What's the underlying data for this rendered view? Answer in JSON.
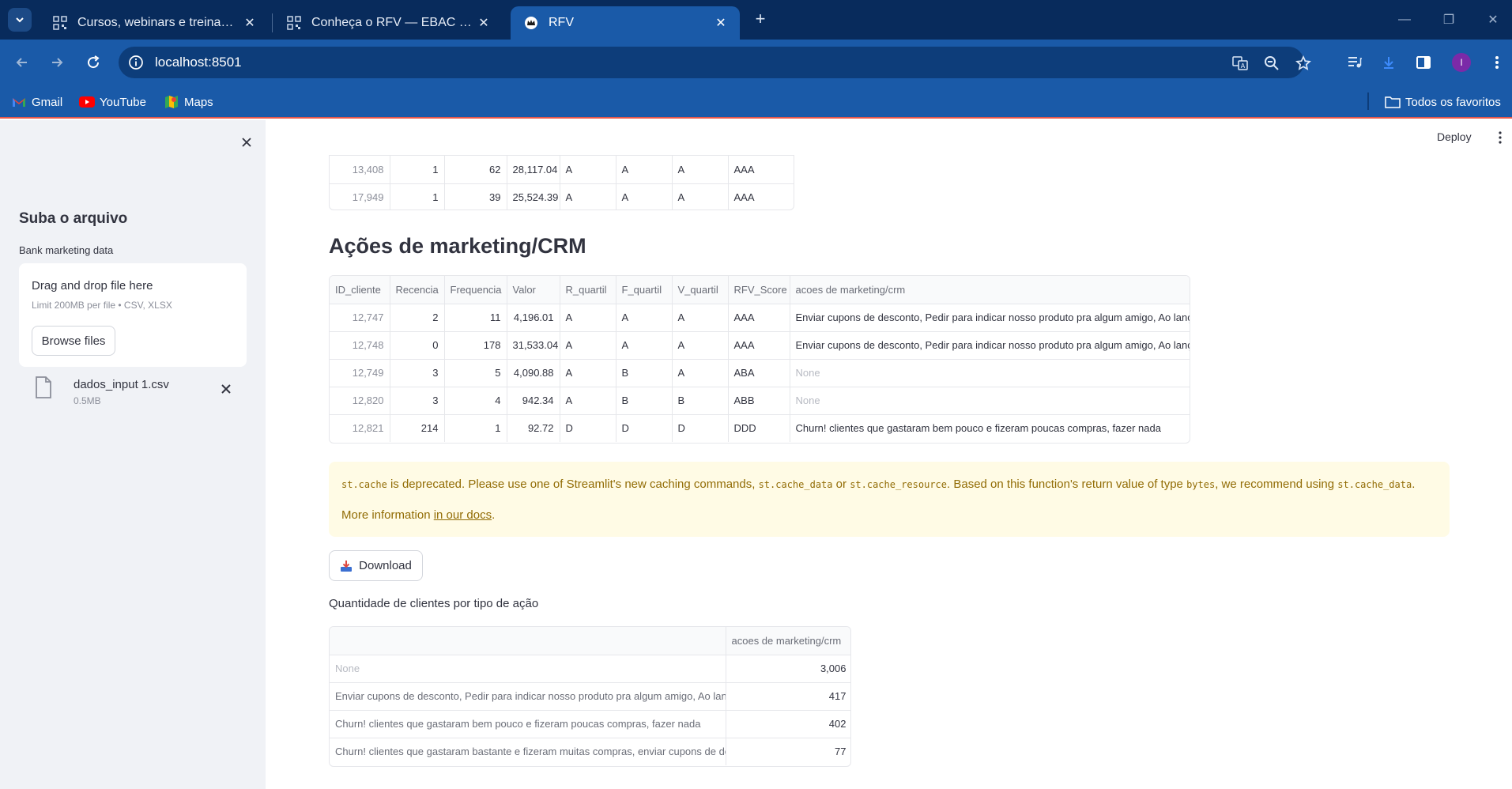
{
  "browser": {
    "tabs": [
      {
        "title": "Cursos, webinars e treinamentos",
        "active": false
      },
      {
        "title": "Conheça o RFV — EBAC LMS",
        "active": false
      },
      {
        "title": "RFV",
        "active": true
      }
    ],
    "url": "localhost:8501",
    "bookmarks": [
      "Gmail",
      "YouTube",
      "Maps"
    ],
    "all_bookmarks": "Todos os favoritos",
    "avatar_letter": "I"
  },
  "sidebar": {
    "heading": "Suba o arquivo",
    "uploader_label": "Bank marketing data",
    "dropzone_title": "Drag and drop file here",
    "dropzone_limit": "Limit 200MB per file • CSV, XLSX",
    "browse_label": "Browse files",
    "file_name": "dados_input 1.csv",
    "file_size": "0.5MB"
  },
  "header": {
    "deploy_label": "Deploy"
  },
  "top_table": {
    "rows": [
      [
        "13,408",
        "1",
        "62",
        "28,117.04",
        "A",
        "A",
        "A",
        "AAA"
      ],
      [
        "17,949",
        "1",
        "39",
        "25,524.39",
        "A",
        "A",
        "A",
        "AAA"
      ]
    ]
  },
  "section_title": "Ações de marketing/CRM",
  "crm_table": {
    "columns": [
      "ID_cliente",
      "Recencia",
      "Frequencia",
      "Valor",
      "R_quartil",
      "F_quartil",
      "V_quartil",
      "RFV_Score",
      "acoes de marketing/crm"
    ],
    "rows": [
      [
        "12,747",
        "2",
        "11",
        "4,196.01",
        "A",
        "A",
        "A",
        "AAA",
        "Enviar cupons de desconto, Pedir para indicar nosso produto pra algum amigo, Ao lançar um novo produto enviar amostras grátis para esses."
      ],
      [
        "12,748",
        "0",
        "178",
        "31,533.04",
        "A",
        "A",
        "A",
        "AAA",
        "Enviar cupons de desconto, Pedir para indicar nosso produto pra algum amigo, Ao lançar um novo produto enviar amostras grátis para esses."
      ],
      [
        "12,749",
        "3",
        "5",
        "4,090.88",
        "A",
        "B",
        "A",
        "ABA",
        "None"
      ],
      [
        "12,820",
        "3",
        "4",
        "942.34",
        "A",
        "B",
        "B",
        "ABB",
        "None"
      ],
      [
        "12,821",
        "214",
        "1",
        "92.72",
        "D",
        "D",
        "D",
        "DDD",
        "Churn! clientes que gastaram bem pouco e fizeram poucas compras, fazer nada"
      ]
    ]
  },
  "warning": {
    "code1": "st.cache",
    "text1": " is deprecated. Please use one of Streamlit's new caching commands, ",
    "code2": "st.cache_data",
    "text2": " or ",
    "code3": "st.cache_resource",
    "text3": ". Based on this function's return value of type ",
    "code4": "bytes",
    "text4": ", we recommend using ",
    "code5": "st.cache_data",
    "text5": ".",
    "more_prefix": "More information ",
    "link": "in our docs",
    "more_suffix": "."
  },
  "download_label": "Download",
  "caption": "Quantidade de clientes por tipo de ação",
  "count_table": {
    "column": "acoes de marketing/crm",
    "rows": [
      [
        "None",
        "3,006"
      ],
      [
        "Enviar cupons de desconto, Pedir para indicar nosso produto pra algum amigo, Ao lançar um novo produto enviar amostras grátis para esses.",
        "417"
      ],
      [
        "Churn! clientes que gastaram bem pouco e fizeram poucas compras, fazer nada",
        "402"
      ],
      [
        "Churn! clientes que gastaram bastante e fizeram muitas compras, enviar cupons de desconto para tentar recuperar",
        "77"
      ]
    ]
  }
}
